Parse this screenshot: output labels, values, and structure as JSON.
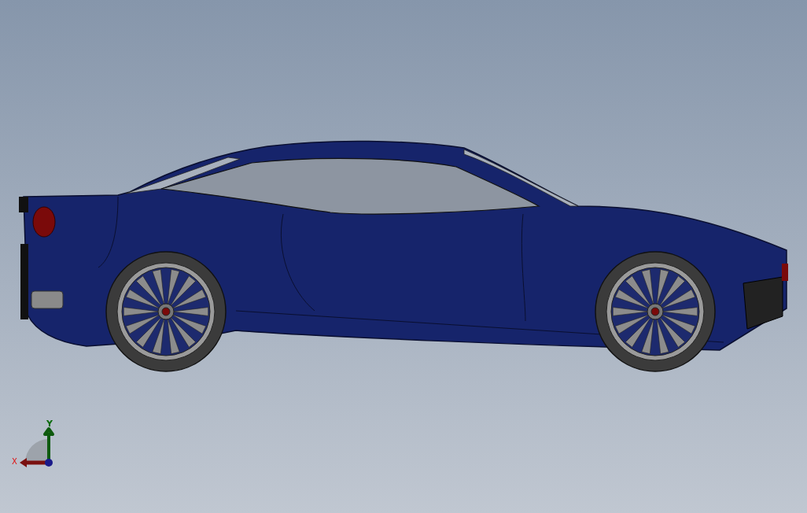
{
  "viewport": {
    "triad": {
      "x_label": "X",
      "y_label": "Y"
    }
  }
}
